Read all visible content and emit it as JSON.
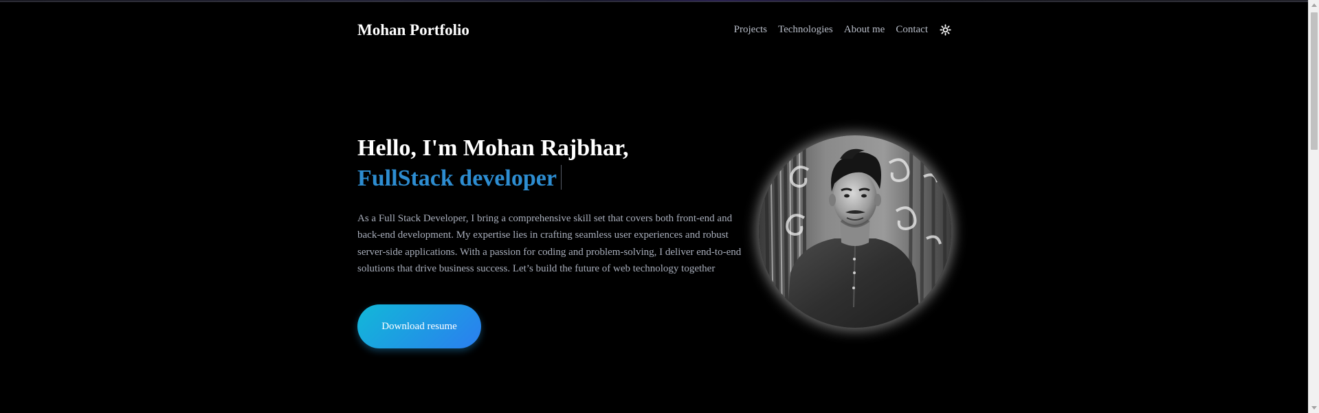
{
  "header": {
    "brand": "Mohan Portfolio",
    "nav": [
      {
        "label": "Projects"
      },
      {
        "label": "Technologies"
      },
      {
        "label": "About me"
      },
      {
        "label": "Contact"
      }
    ],
    "theme_toggle_icon": "sun-icon"
  },
  "hero": {
    "greeting": "Hello, I'm Mohan Rajbhar,",
    "role": "FullStack developer",
    "description": "As a Full Stack Developer, I bring a comprehensive skill set that covers both front-end and back-end development. My expertise lies in crafting seamless user experiences and robust server-side applications. With a passion for coding and problem-solving, I deliver end-to-end solutions that drive business success. Let’s build the future of web technology together",
    "cta_label": "Download resume",
    "avatar_icon": "profile-photo"
  },
  "colors": {
    "background": "#000000",
    "accent": "#2d8dd1",
    "text": "#ffffff",
    "muted_text": "#a8aebb",
    "button_gradient_start": "#12b8d8",
    "button_gradient_end": "#2b7ef0"
  }
}
